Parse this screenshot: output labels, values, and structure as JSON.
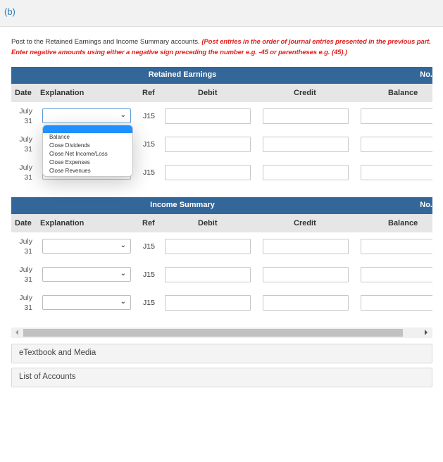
{
  "part": {
    "label": "(b)"
  },
  "instructions": {
    "plain": "Post to the Retained Earnings and Income Summary accounts.",
    "emphasis": "(Post entries in the order of journal entries presented in the previous part. Enter negative amounts using either a negative sign preceding the number e.g. -45 or parentheses e.g. (45).)"
  },
  "columns": {
    "date": "Date",
    "explanation": "Explanation",
    "ref": "Ref",
    "debit": "Debit",
    "credit": "Credit",
    "balance": "Balance"
  },
  "ledgers": [
    {
      "title": "Retained Earnings",
      "no_label": "No.",
      "rows": [
        {
          "month": "July",
          "day": "31",
          "explanation": "",
          "ref": "J15",
          "debit": "",
          "credit": "",
          "balance": ""
        },
        {
          "month": "July",
          "day": "31",
          "explanation": "",
          "ref": "J15",
          "debit": "",
          "credit": "",
          "balance": ""
        },
        {
          "month": "July",
          "day": "31",
          "explanation": "",
          "ref": "J15",
          "debit": "",
          "credit": "",
          "balance": ""
        }
      ]
    },
    {
      "title": "Income Summary",
      "no_label": "No.",
      "rows": [
        {
          "month": "July",
          "day": "31",
          "explanation": "",
          "ref": "J15",
          "debit": "",
          "credit": "",
          "balance": ""
        },
        {
          "month": "July",
          "day": "31",
          "explanation": "",
          "ref": "J15",
          "debit": "",
          "credit": "",
          "balance": ""
        },
        {
          "month": "July",
          "day": "31",
          "explanation": "",
          "ref": "J15",
          "debit": "",
          "credit": "",
          "balance": ""
        }
      ]
    }
  ],
  "dropdown": {
    "options": [
      "",
      "Balance",
      "Close Dividends",
      "Close Net Income/Loss",
      "Close Expenses",
      "Close Revenues"
    ],
    "selected_index": 0
  },
  "icons": {
    "select_chevron": "chevron-down-icon"
  },
  "panels": {
    "etextbook": "eTextbook and Media",
    "list_of_accounts": "List of Accounts"
  },
  "colors": {
    "title_bar": "#336699",
    "header_row": "#e6e6e6",
    "instruction_emphasis": "#e02020",
    "part_label": "#2a7ab8",
    "dropdown_highlight": "#1e90ff"
  }
}
